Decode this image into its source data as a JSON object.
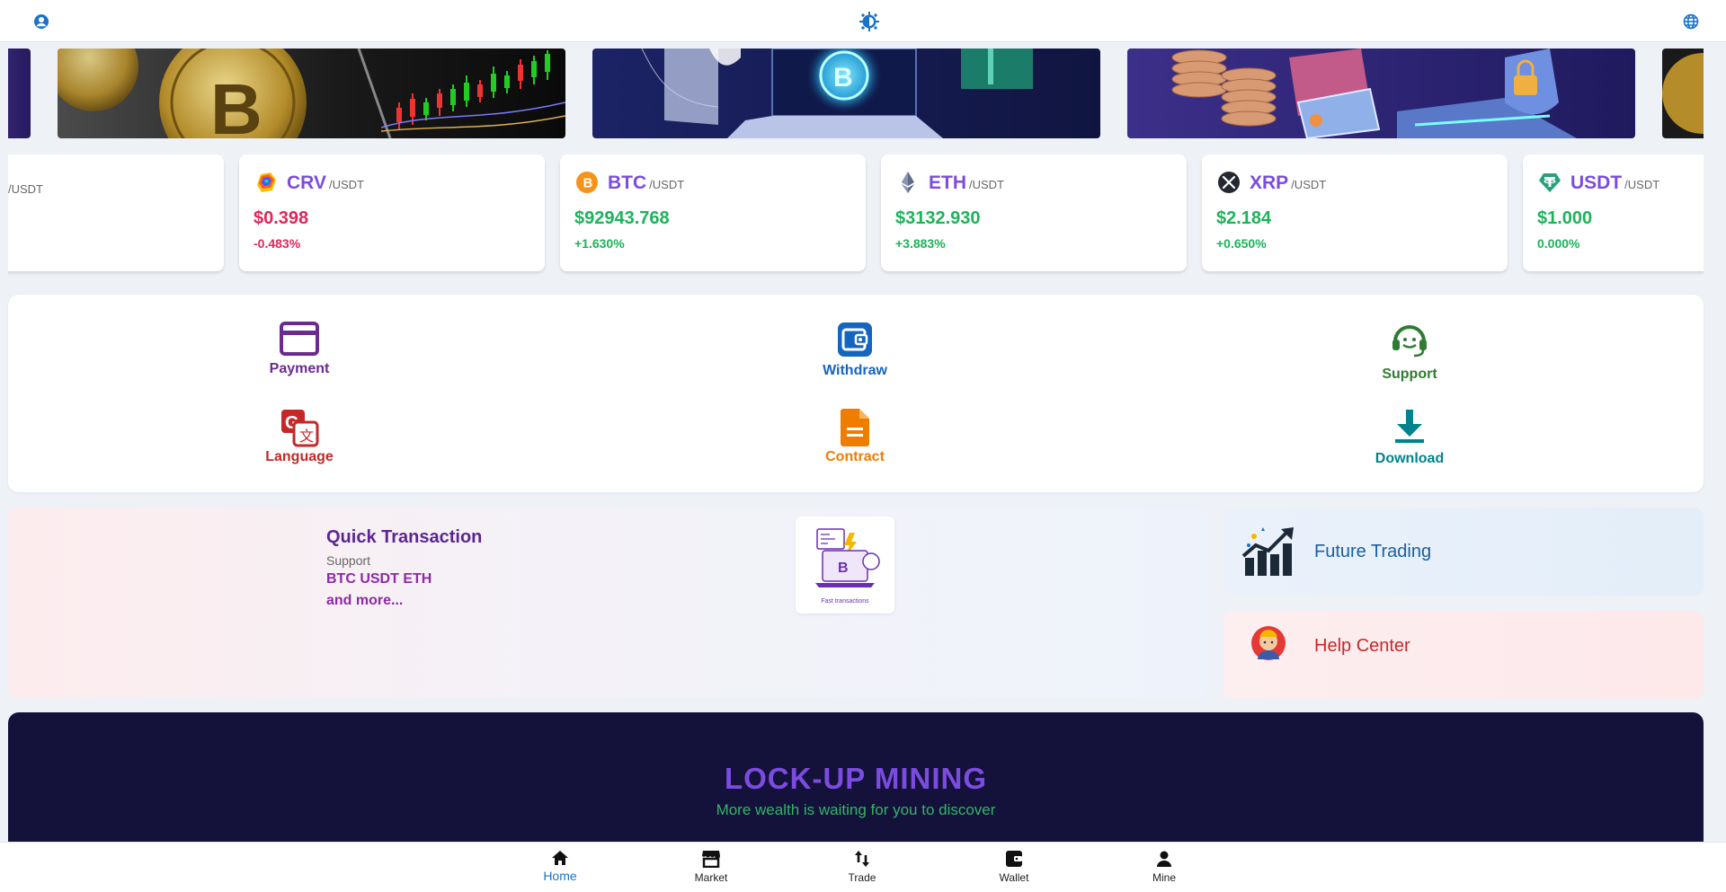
{
  "header": {
    "left_icon": "user-circle-icon",
    "center_icon": "theme-toggle-icon",
    "right_icon": "globe-icon"
  },
  "banners": [
    "bitcoin-chart-banner",
    "bitcoin-laptop-banner",
    "crypto-coins-security-banner"
  ],
  "tickers": [
    {
      "pair": "/USDT"
    },
    {
      "symbol": "CRV",
      "pair": "/USDT",
      "price": "$0.398",
      "change": "-0.483%",
      "direction": "down",
      "icon": "crv-logo-icon"
    },
    {
      "symbol": "BTC",
      "pair": "/USDT",
      "price": "$92943.768",
      "change": "+1.630%",
      "direction": "up",
      "icon": "btc-logo-icon"
    },
    {
      "symbol": "ETH",
      "pair": "/USDT",
      "price": "$3132.930",
      "change": "+3.883%",
      "direction": "up",
      "icon": "eth-logo-icon"
    },
    {
      "symbol": "XRP",
      "pair": "/USDT",
      "price": "$2.184",
      "change": "+0.650%",
      "direction": "up",
      "icon": "xrp-logo-icon"
    },
    {
      "symbol": "USDT",
      "pair": "/USDT",
      "price": "$1.000",
      "change": "0.000%",
      "direction": "up",
      "icon": "usdt-logo-icon"
    }
  ],
  "menu": {
    "payment": {
      "label": "Payment",
      "color": "#6b2a8f",
      "icon": "credit-card-icon"
    },
    "withdraw": {
      "label": "Withdraw",
      "color": "#1565c0",
      "icon": "wallet-icon"
    },
    "support": {
      "label": "Support",
      "color": "#2e7d32",
      "icon": "headset-icon"
    },
    "language": {
      "label": "Language",
      "color": "#c62828",
      "icon": "translate-icon"
    },
    "contract": {
      "label": "Contract",
      "color": "#ef7d00",
      "icon": "document-icon"
    },
    "download": {
      "label": "Download",
      "color": "#00838f",
      "icon": "download-icon"
    }
  },
  "quick": {
    "title": "Quick Transaction ",
    "support_label": "Support",
    "coins": "BTC  USDT  ETH ",
    "more": "and more... ",
    "image_caption": "Fast transactions"
  },
  "side": {
    "future_trading": "Future Trading",
    "help_center": "Help Center"
  },
  "mining": {
    "title": "LOCK-UP MINING",
    "subtitle": "More wealth is waiting for you to discover "
  },
  "nav": [
    {
      "label": "Home",
      "icon": "home-icon",
      "active": true
    },
    {
      "label": "Market",
      "icon": "market-store-icon"
    },
    {
      "label": "Trade",
      "icon": "trade-arrows-icon"
    },
    {
      "label": "Wallet",
      "icon": "wallet-icon"
    },
    {
      "label": "Mine",
      "icon": "user-icon"
    }
  ],
  "colors": {
    "accent": "#7b4ce0",
    "up": "#1cb35a",
    "down": "#e0265a",
    "nav_active": "#1a73c9"
  }
}
